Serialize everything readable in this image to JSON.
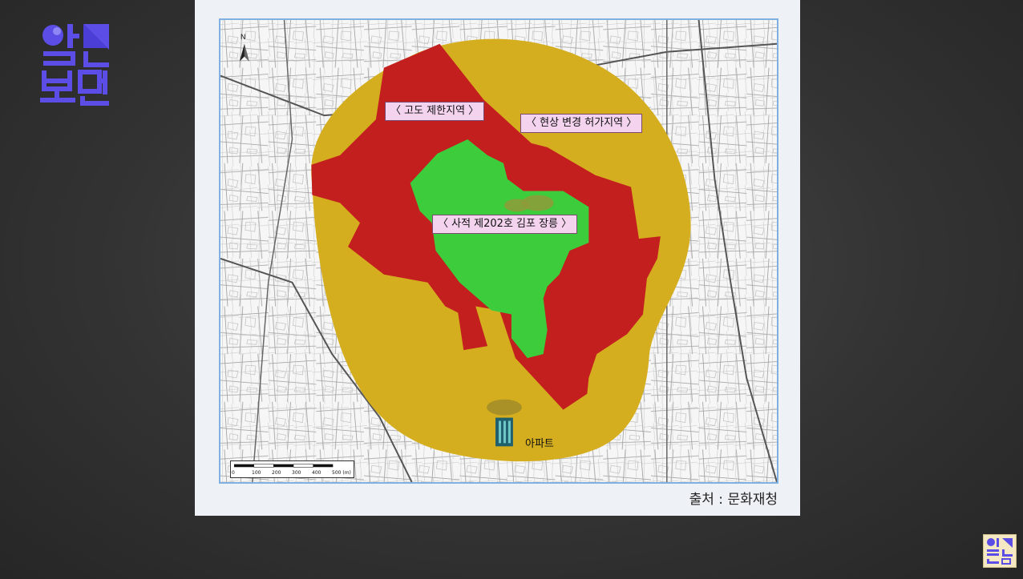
{
  "logo": {
    "name": "알고 보면"
  },
  "map": {
    "north_label": "N",
    "labels": {
      "altitude_zone": "〈 고도 제한지역 〉",
      "change_permit_zone": "〈 현상 변경 허가지역 〉",
      "heritage_site": "〈 사적 제202호 김포 장릉 〉",
      "apartment": "아파트"
    },
    "scale": {
      "ticks": [
        "0",
        "100",
        "200",
        "300",
        "400",
        "500 (m)"
      ]
    },
    "colors": {
      "change_permit_zone": "#d4ae1e",
      "altitude_zone": "#c31f1f",
      "heritage_site": "#3ccc3c",
      "label_bg": "#f4d3ef"
    }
  },
  "source": "출처 : 문화재청"
}
